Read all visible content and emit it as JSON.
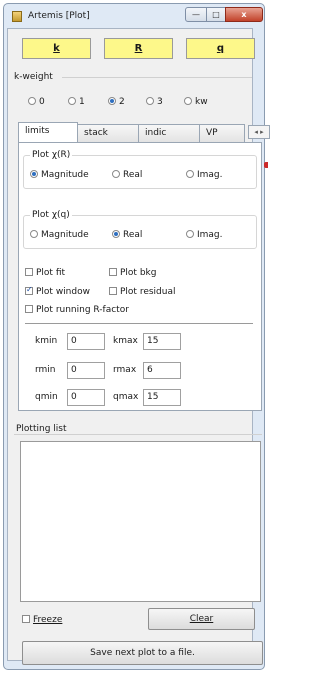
{
  "window": {
    "title": "Artemis [Plot]",
    "minimize_glyph": "—",
    "maximize_glyph": "□",
    "close_glyph": "x"
  },
  "toolbar": {
    "k_label": "k",
    "r_label": "R",
    "q_label": "q"
  },
  "kweight": {
    "label": "k-weight",
    "options": [
      "0",
      "1",
      "2",
      "3",
      "kw"
    ],
    "selected": "2"
  },
  "tabs": {
    "items": [
      "limits",
      "stack",
      "indic",
      "VP"
    ],
    "active": "limits",
    "scroll_glyph": "◂ ▸"
  },
  "limits": {
    "plot_xr_label": "Plot χ(R)",
    "plot_xr_options": [
      "Magnitude",
      "Real",
      "Imag."
    ],
    "plot_xr_selected": "Magnitude",
    "plot_xq_label": "Plot χ(q)",
    "plot_xq_options": [
      "Magnitude",
      "Real",
      "Imag."
    ],
    "plot_xq_selected": "Real",
    "checks": [
      {
        "label": "Plot fit",
        "checked": false
      },
      {
        "label": "Plot bkg",
        "checked": false
      },
      {
        "label": "Plot window",
        "checked": true
      },
      {
        "label": "Plot residual",
        "checked": false
      },
      {
        "label": "Plot running R-factor",
        "checked": false
      }
    ],
    "fields": {
      "kmin_label": "kmin",
      "kmin": "0",
      "kmax_label": "kmax",
      "kmax": "15",
      "rmin_label": "rmin",
      "rmin": "0",
      "rmax_label": "rmax",
      "rmax": "6",
      "qmin_label": "qmin",
      "qmin": "0",
      "qmax_label": "qmax",
      "qmax": "15"
    }
  },
  "plotting_list": {
    "label": "Plotting list"
  },
  "bottom": {
    "freeze_label": "Freeze",
    "freeze_checked": false,
    "clear_label": "Clear",
    "save_label": "Save next plot to a file."
  }
}
